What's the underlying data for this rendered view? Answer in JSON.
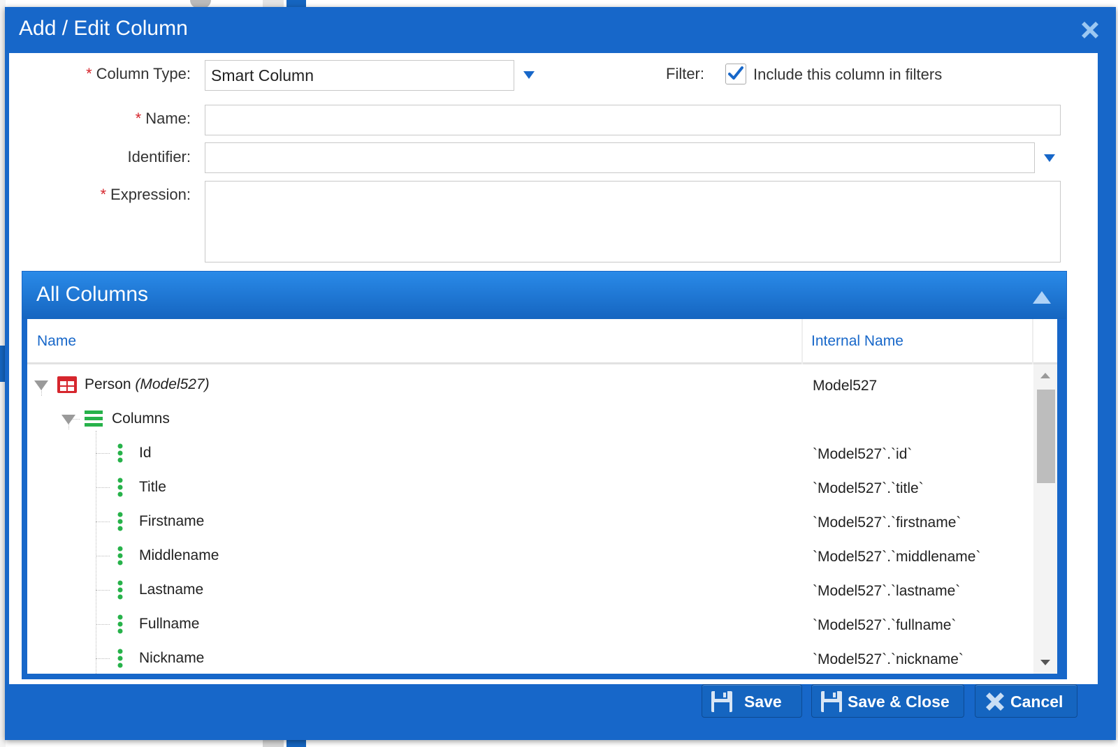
{
  "dialog": {
    "title": "Add / Edit Column"
  },
  "form": {
    "column_type": {
      "required_mark": "*",
      "label": "Column Type:",
      "value": "Smart Column"
    },
    "filter": {
      "label": "Filter:",
      "checkbox_label": "Include this column in filters",
      "checked": true
    },
    "name": {
      "required_mark": "*",
      "label": "Name:",
      "value": ""
    },
    "identifier": {
      "label": "Identifier:",
      "value": ""
    },
    "expression": {
      "required_mark": "*",
      "label": "Expression:",
      "value": ""
    }
  },
  "all_columns": {
    "title": "All Columns",
    "headers": {
      "name": "Name",
      "internal_name": "Internal Name"
    },
    "tree": {
      "root": {
        "name": "Person",
        "model": "(Model527)",
        "internal": "Model527"
      },
      "group": {
        "name": "Columns"
      },
      "columns": [
        {
          "name": "Id",
          "internal": "`Model527`.`id`"
        },
        {
          "name": "Title",
          "internal": "`Model527`.`title`"
        },
        {
          "name": "Firstname",
          "internal": "`Model527`.`firstname`"
        },
        {
          "name": "Middlename",
          "internal": "`Model527`.`middlename`"
        },
        {
          "name": "Lastname",
          "internal": "`Model527`.`lastname`"
        },
        {
          "name": "Fullname",
          "internal": "`Model527`.`fullname`"
        },
        {
          "name": "Nickname",
          "internal": "`Model527`.`nickname`"
        }
      ]
    }
  },
  "footer": {
    "save_label": "Save",
    "save_close_label": "Save & Close",
    "cancel_label": "Cancel"
  },
  "icons": {
    "close": "close-icon",
    "table": "table-icon",
    "list": "list-icon",
    "column": "column-icon",
    "save": "floppy-disk-icon",
    "cancel": "x-icon"
  },
  "colors": {
    "primary": "#1767c9",
    "header_gradient_top": "#2a8ae8",
    "required": "#d6262d",
    "table_icon": "#d6262d",
    "column_icon": "#27b24a"
  }
}
